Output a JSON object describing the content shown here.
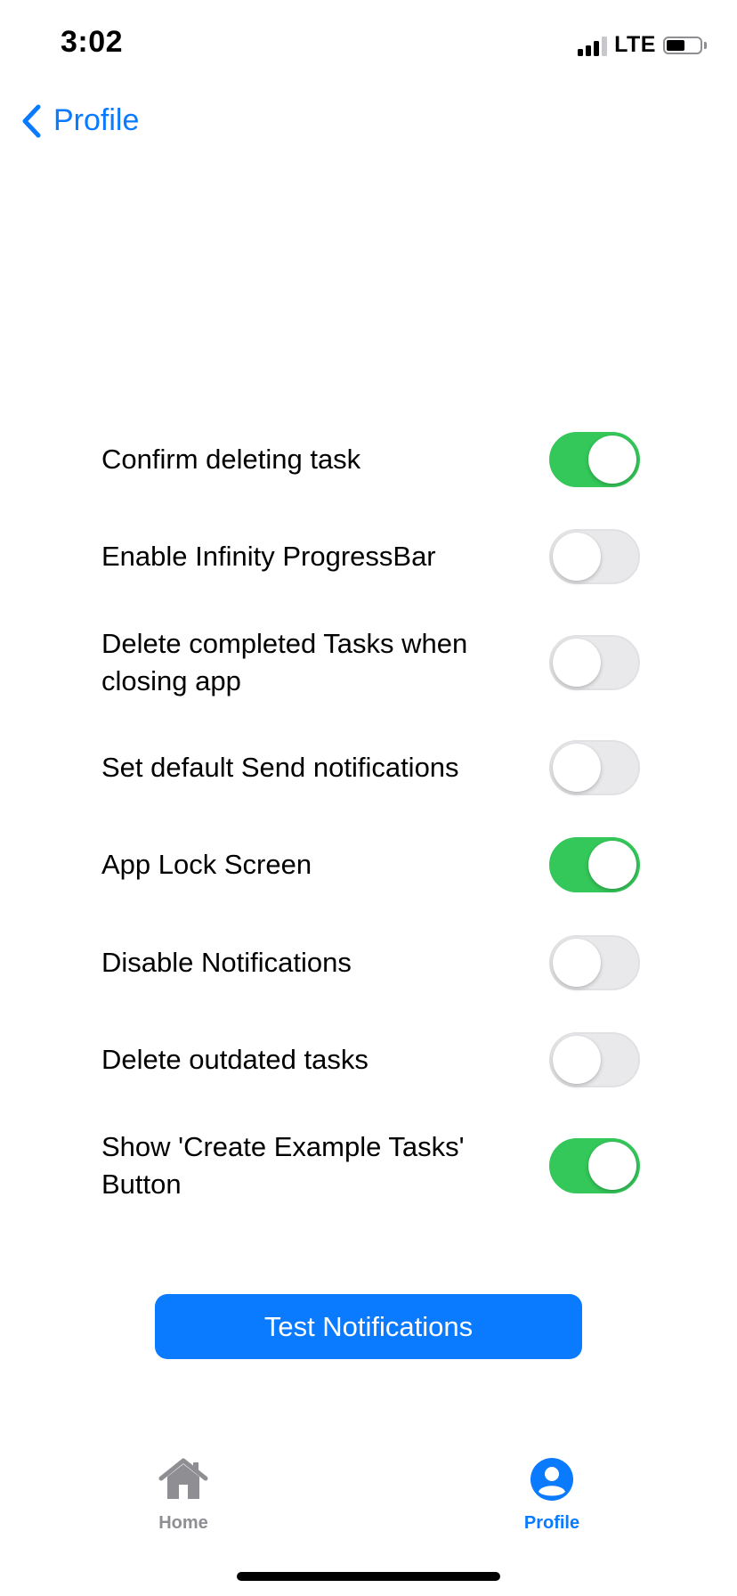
{
  "status_bar": {
    "time": "3:02",
    "network": "LTE",
    "battery_level": 0.55
  },
  "nav": {
    "back_label": "Profile",
    "accent_color": "#0a7aff"
  },
  "settings": [
    {
      "label": "Confirm deleting task",
      "enabled": true
    },
    {
      "label": "Enable Infinity ProgressBar",
      "enabled": false
    },
    {
      "label": "Delete completed Tasks when closing app",
      "enabled": false
    },
    {
      "label": "Set default Send notifications",
      "enabled": false
    },
    {
      "label": "App Lock Screen",
      "enabled": true
    },
    {
      "label": "Disable Notifications",
      "enabled": false
    },
    {
      "label": "Delete outdated tasks",
      "enabled": false
    },
    {
      "label": "Show 'Create Example Tasks' Button",
      "enabled": true
    }
  ],
  "toggle_on_color": "#34c759",
  "test_button": {
    "label": "Test Notifications"
  },
  "tab_bar": {
    "tabs": [
      {
        "label": "Home",
        "icon": "house-icon",
        "active": false
      },
      {
        "label": "Profile",
        "icon": "person-circle-icon",
        "active": true
      }
    ]
  }
}
